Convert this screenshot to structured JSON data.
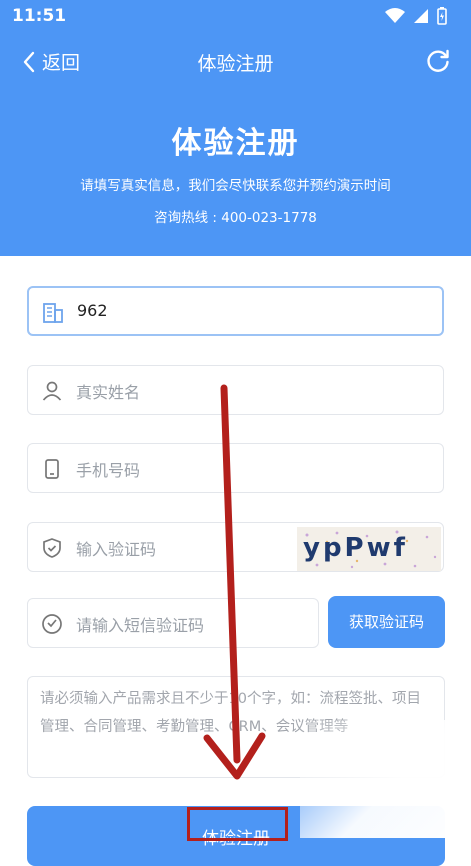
{
  "status_bar": {
    "time": "11:51"
  },
  "nav": {
    "back_label": "返回",
    "title": "体验注册"
  },
  "header": {
    "title": "体验注册",
    "subtitle": "请填写真实信息，我们会尽快联系您并预约演示时间",
    "hotline": "咨询热线 : 400-023-1778"
  },
  "form": {
    "company_value": "962",
    "name_placeholder": "真实姓名",
    "phone_placeholder": "手机号码",
    "captcha_placeholder": "输入验证码",
    "captcha_text": "ypPwf",
    "sms_placeholder": "请输入短信验证码",
    "sms_button": "获取验证码",
    "requirement_placeholder": "请必须输入产品需求且不少于10个字，如：流程签批、项目管理、合同管理、考勤管理、CRM、会议管理等",
    "submit_label": "体验注册"
  },
  "colors": {
    "accent": "#4d96f5",
    "annotation": "#b3201c"
  }
}
